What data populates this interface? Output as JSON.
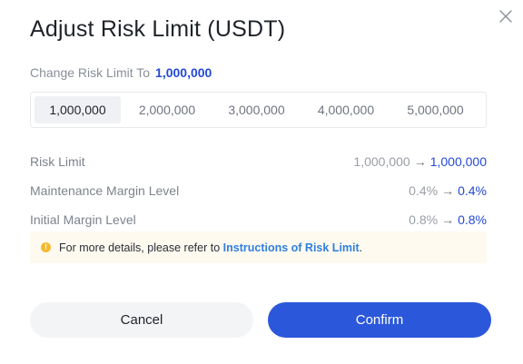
{
  "dialog": {
    "title": "Adjust Risk Limit (USDT)",
    "close_icon": "close-icon"
  },
  "change": {
    "label": "Change Risk Limit To",
    "value": "1,000,000"
  },
  "options": [
    {
      "label": "1,000,000",
      "selected": true
    },
    {
      "label": "2,000,000",
      "selected": false
    },
    {
      "label": "3,000,000",
      "selected": false
    },
    {
      "label": "4,000,000",
      "selected": false
    },
    {
      "label": "5,000,000",
      "selected": false
    }
  ],
  "details": {
    "arrow": "→",
    "rows": [
      {
        "label": "Risk Limit",
        "old": "1,000,000",
        "new": "1,000,000"
      },
      {
        "label": "Maintenance Margin Level",
        "old": "0.4%",
        "new": "0.4%"
      },
      {
        "label": "Initial Margin Level",
        "old": "0.8%",
        "new": "0.8%"
      }
    ]
  },
  "notice": {
    "icon": "info-icon",
    "icon_glyph": "!",
    "text": "For more details, please refer to ",
    "link": "Instructions of Risk Limit",
    "suffix": "."
  },
  "buttons": {
    "cancel": "Cancel",
    "confirm": "Confirm"
  },
  "colors": {
    "accent": "#2349d6",
    "confirm_bg": "#2b57db",
    "link": "#2f7fe0",
    "notice_bg": "#fffaf0",
    "warning": "#f5b82e"
  }
}
